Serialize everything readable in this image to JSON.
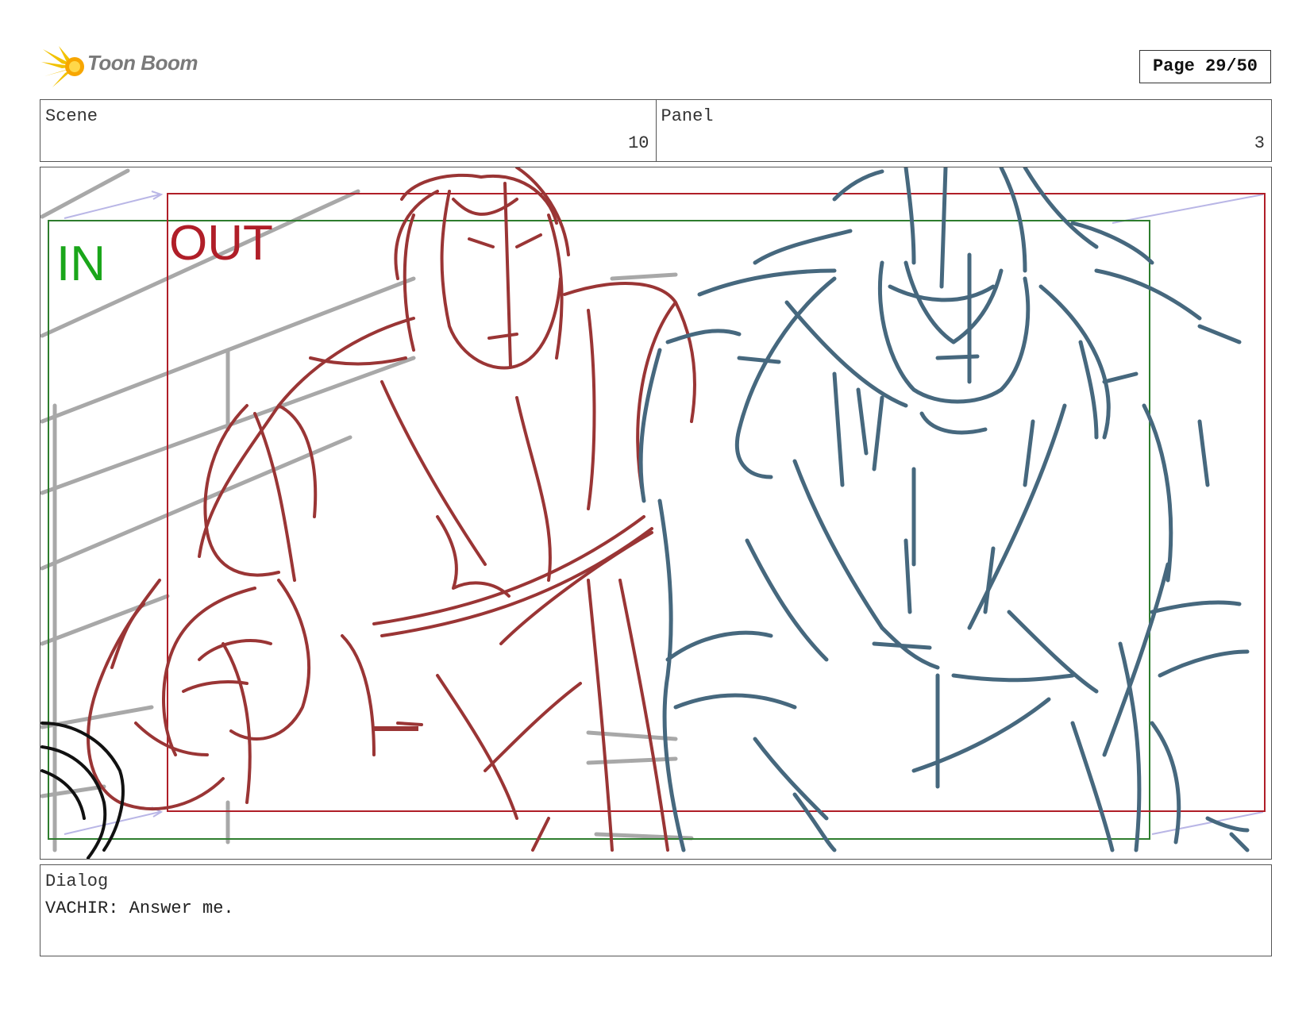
{
  "header": {
    "logo_text": "Toon Boom",
    "page_label": "Page 29/50"
  },
  "info": {
    "scene_label": "Scene",
    "scene_value": "10",
    "panel_label": "Panel",
    "panel_value": "3"
  },
  "panel": {
    "in_label": "IN",
    "out_label": "OUT",
    "colors": {
      "in_frame": "#2e7d2e",
      "out_frame": "#b01e28",
      "character_left": "#9a3535",
      "character_right": "#46687e",
      "background_lines": "#a8a8a8"
    }
  },
  "dialog": {
    "label": "Dialog",
    "text": "VACHIR: Answer me."
  }
}
